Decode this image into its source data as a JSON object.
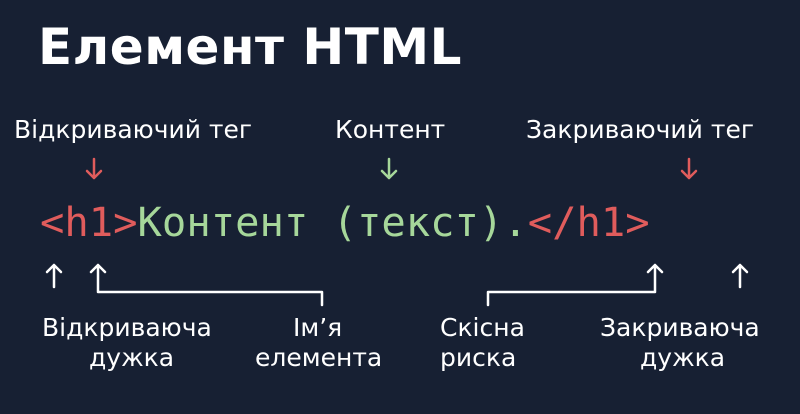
{
  "title": "Елемент HTML",
  "labels": {
    "opening_tag": "Відкриваючий тег",
    "content": "Контент",
    "closing_tag": "Закриваючий тег",
    "opening_bracket": [
      "Відкриваюча",
      "дужка"
    ],
    "element_name": [
      "Ім’я",
      "елемента"
    ],
    "slash": [
      "Скісна",
      "риска"
    ],
    "closing_bracket": [
      "Закриваюча",
      "дужка"
    ]
  },
  "code": {
    "open_tag": "<h1>",
    "content": "Контент (текст).",
    "close_tag": "</h1>"
  },
  "colors": {
    "background": "#172033",
    "tag": "#e05c5c",
    "content": "#a6d79a",
    "text": "#ffffff"
  },
  "icons": {
    "down_arrow": "down-arrow-icon",
    "up_arrow": "up-arrow-icon"
  }
}
